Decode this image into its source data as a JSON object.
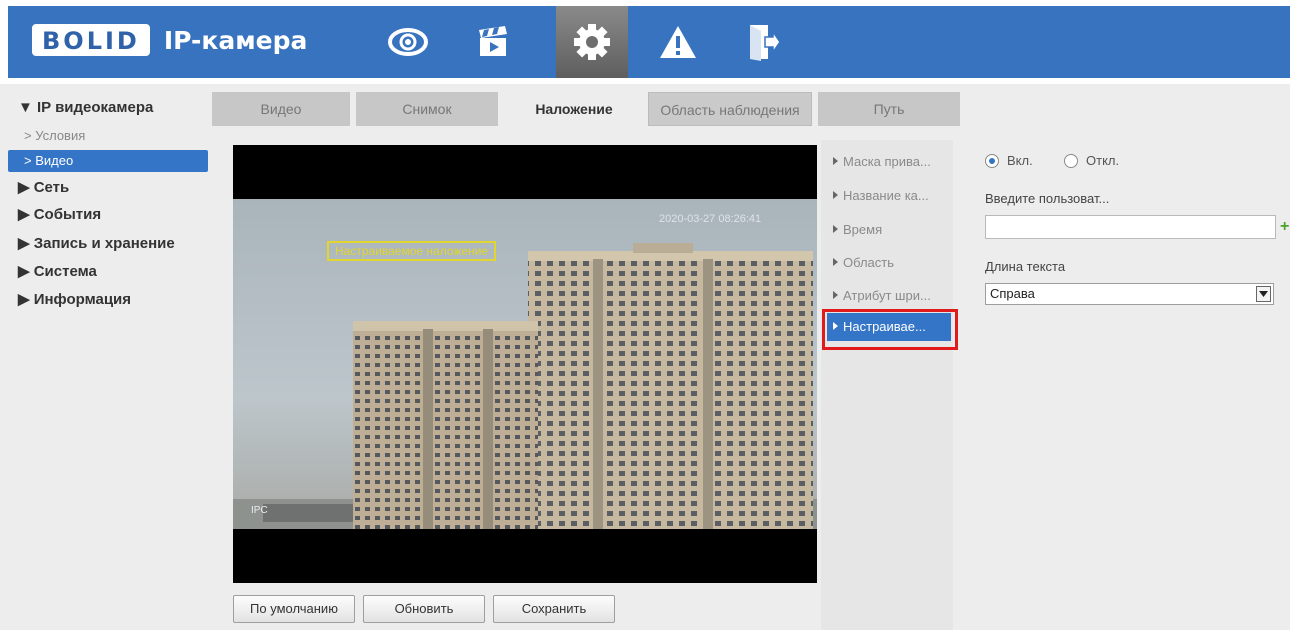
{
  "header": {
    "logo": "BOLID",
    "title": "IP-камера",
    "nav": [
      {
        "icon": "eye-icon"
      },
      {
        "icon": "clapperboard-icon"
      },
      {
        "icon": "gear-icon",
        "active": true
      },
      {
        "icon": "warning-icon"
      },
      {
        "icon": "exit-icon"
      }
    ],
    "bar_color": "#3873bf"
  },
  "sidebar": {
    "items": [
      {
        "label": "▼ IP видеокамера"
      },
      {
        "label": "> Условия"
      },
      {
        "label": "> Видео",
        "active": true
      },
      {
        "label": "▶ Сеть"
      },
      {
        "label": "▶ События"
      },
      {
        "label": "▶ Запись и хранение"
      },
      {
        "label": "▶ Система"
      },
      {
        "label": "▶ Информация"
      }
    ]
  },
  "tabs": [
    {
      "label": "Видео"
    },
    {
      "label": "Снимок"
    },
    {
      "label": "Наложение",
      "active": true
    },
    {
      "label": "Область наблюдения"
    },
    {
      "label": "Путь"
    }
  ],
  "video": {
    "overlay_text": "Настраиваемое наложение",
    "timestamp": "2020-03-27 08:26:41",
    "channel": "IPC"
  },
  "submenu": {
    "items": [
      {
        "label": "Маска прива..."
      },
      {
        "label": "Название ка..."
      },
      {
        "label": "Время"
      },
      {
        "label": "Область"
      },
      {
        "label": "Атрибут шри..."
      },
      {
        "label": "Настраивае...",
        "active": true
      }
    ]
  },
  "settings": {
    "radio_on": "Вкл.",
    "radio_off": "Откл.",
    "text_label": "Введите пользоват...",
    "text_value": "",
    "plus": "+",
    "length_label": "Длина текста",
    "length_value": "Справа"
  },
  "buttons": {
    "default": "По умолчанию",
    "refresh": "Обновить",
    "save": "Сохранить"
  },
  "colors": {
    "accent": "#3575c7",
    "highlight": "#e11b1b",
    "overlay": "#e2d52e"
  }
}
